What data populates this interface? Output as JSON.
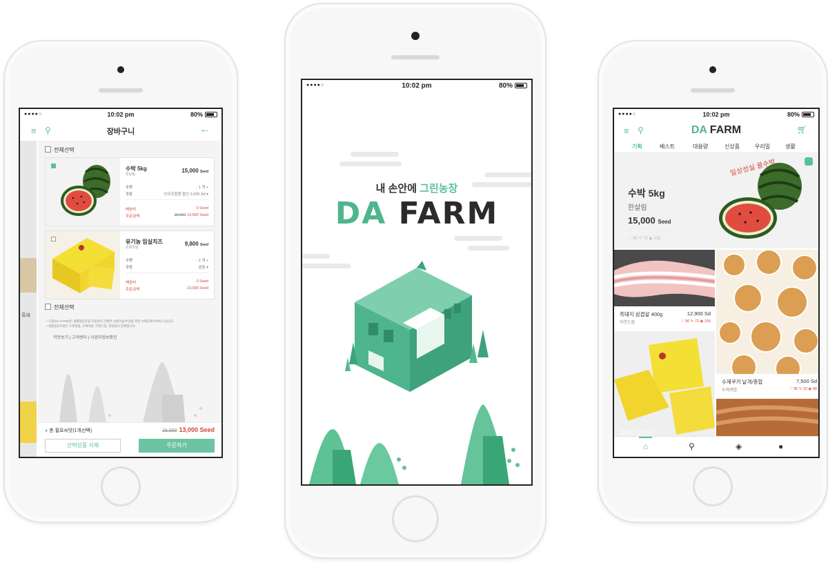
{
  "status": {
    "signal": "●●●●○",
    "time": "10:02 pm",
    "battery": "80%"
  },
  "left": {
    "title": "장바구니",
    "select_all": "전체선택",
    "items": [
      {
        "name": "수박 5kg",
        "brand": "한살림",
        "price": "15,000",
        "unit": "Seed",
        "qty_label": "수량",
        "qty": "- 1 개 +",
        "coupon_label": "쿠폰",
        "coupon": "신규조합원 할인 2,000 Sd ▾",
        "ship_label": "배송비",
        "ship": "0 Seed",
        "total_label": "주문금액",
        "total_old": "15,000",
        "total": "13,000 Seed"
      },
      {
        "name": "유기농 임실치즈",
        "brand": "초록마을",
        "price": "9,800",
        "unit": "Seed",
        "qty_label": "수량",
        "qty": "- 2 개 +",
        "coupon_label": "쿠폰",
        "coupon": "없음 ▾",
        "ship_label": "배송비",
        "ship": "0 Seed",
        "total_label": "주문금액",
        "total": "13,000 Seed"
      }
    ],
    "notice_1": "• 디팜(DA FARM)은 생활협동조합 조합원의 간편한 상품이용/수령을 위한 브레딩판의서비스입니다.",
    "notice_2": "• 생활협동조합은 두레생협, 초록마을, 자연드림, 한살림이 함께합니다.",
    "footer_links": "약관보기  |  고객센터  |  사업자정보확인",
    "total_label": "총 필요씨앗(1개선택)",
    "total_old": "15,000",
    "total_price": "13,000 Seed",
    "delete_button": "선택상품 삭제",
    "order_button": "주문하기",
    "side_text": "흑돼"
  },
  "center": {
    "tagline_pre": "내 손안에 ",
    "tagline_green": "그린농장",
    "logo_oa": "DA",
    "logo_farm": " FARM"
  },
  "right": {
    "logo_oa": "DA",
    "logo_farm": " FARM",
    "tabs": [
      "기획",
      "베스트",
      "대용량",
      "신상품",
      "우리밀",
      "생활"
    ],
    "hero": {
      "handwritten": "일상성실 꿀수박",
      "name": "수박 5kg",
      "brand": "한살림",
      "price": "15,000",
      "unit": "Seed",
      "stats": "♡ 96   ✎ 73   ◉ 105"
    },
    "cards": [
      {
        "name": "흑돼지 삼겹살 400g",
        "price": "12,900 Sd",
        "brand": "자연드림",
        "stats": "♡ 96   ✎ 73   ◉ 105"
      },
      {
        "name": "수제쿠키 낱개/종합",
        "price": "7,500 Sd",
        "brand": "두레생협",
        "stats": "♡ 95   ✎ 32   ◉ 88"
      }
    ],
    "cheese_text": "유기농 임실치즈"
  },
  "colors": {
    "brand_green": "#5bbf9a",
    "accent_red": "#d3453b"
  }
}
